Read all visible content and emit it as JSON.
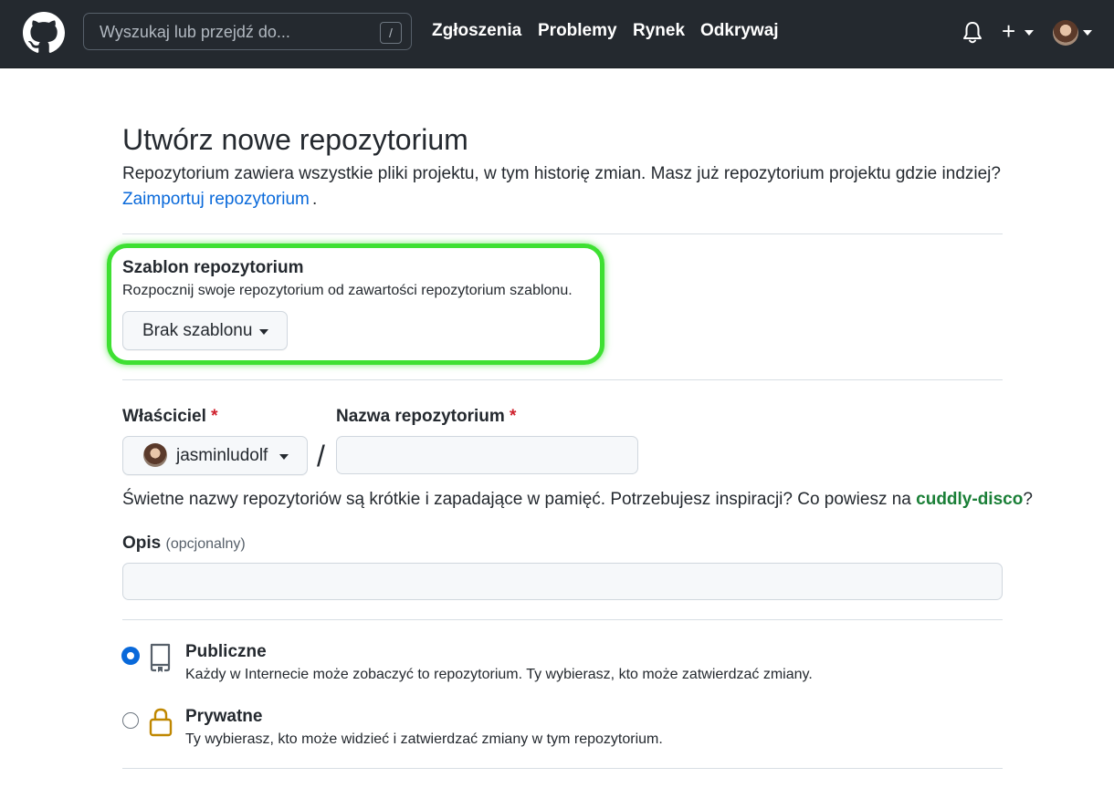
{
  "header": {
    "search_placeholder": "Wyszukaj lub przejdź do...",
    "search_shortcut": "/",
    "nav": [
      "Zgłoszenia",
      "Problemy",
      "Rynek",
      "Odkrywaj"
    ],
    "plus_label": "+"
  },
  "page": {
    "title": "Utwórz nowe repozytorium",
    "lead": "Repozytorium zawiera wszystkie pliki projektu, w tym historię zmian. Masz już repozytorium projektu gdzie indziej?",
    "import_link": "Zaimportuj repozytorium",
    "import_suffix": "."
  },
  "template": {
    "title": "Szablon repozytorium",
    "description": "Rozpocznij swoje repozytorium od zawartości repozytorium szablonu.",
    "button_label": "Brak szablonu"
  },
  "owner": {
    "label": "Właściciel",
    "required_mark": "*",
    "value": "jasminludolf"
  },
  "repo_name": {
    "label": "Nazwa repozytorium",
    "required_mark": "*",
    "value": ""
  },
  "separator": "/",
  "name_hint": {
    "prefix": "Świetne nazwy repozytoriów są krótkie i zapadające w pamięć. Potrzebujesz inspiracji? Co powiesz na ",
    "suggestion": "cuddly-disco",
    "suffix": "?"
  },
  "description_field": {
    "label": "Opis",
    "optional": "(opcjonalny)",
    "value": ""
  },
  "visibility": {
    "public": {
      "title": "Publiczne",
      "description": "Każdy w Internecie może zobaczyć to repozytorium. Ty wybierasz, kto może zatwierdzać zmiany.",
      "selected": true,
      "icon": "repo-icon"
    },
    "private": {
      "title": "Prywatne",
      "description": "Ty wybierasz, kto może widzieć i zatwierdzać zmiany w tym repozytorium.",
      "selected": false,
      "icon": "lock-icon"
    }
  },
  "colors": {
    "header_bg": "#24292f",
    "link": "#0969da",
    "required": "#cf222e",
    "suggestion": "#1a7f37",
    "highlight": "#3ee032"
  }
}
